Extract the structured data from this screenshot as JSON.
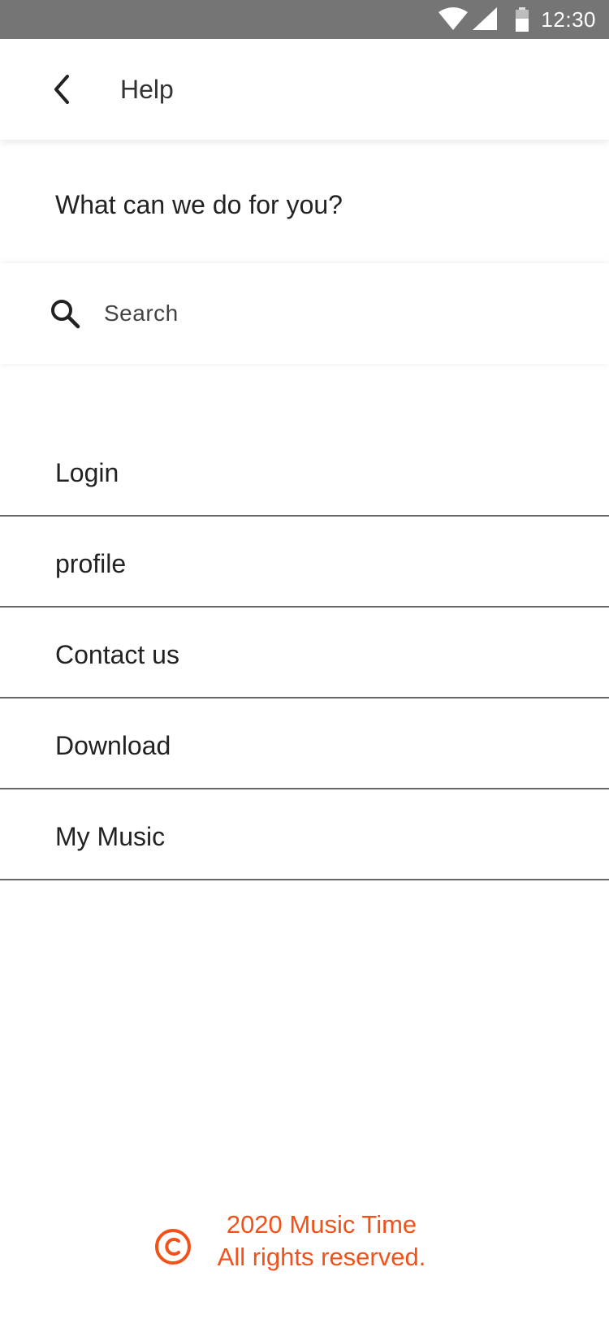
{
  "status_bar": {
    "time": "12:30",
    "icons": [
      "wifi-icon",
      "signal-icon",
      "battery-icon"
    ]
  },
  "app_bar": {
    "back_icon": "chevron-left-icon",
    "title": "Help"
  },
  "prompt": "What can we do for you?",
  "search": {
    "icon": "search-icon",
    "placeholder": "Search",
    "value": ""
  },
  "help_items": [
    {
      "label": "Login"
    },
    {
      "label": "profile"
    },
    {
      "label": "Contact us"
    },
    {
      "label": "Download"
    },
    {
      "label": "My Music"
    }
  ],
  "footer": {
    "icon": "copyright-icon",
    "line1": "2020 Music Time",
    "line2": "All rights reserved."
  },
  "colors": {
    "status_bar": "#757575",
    "accent": "#f2521a",
    "divider": "#666666",
    "text": "#222222"
  }
}
